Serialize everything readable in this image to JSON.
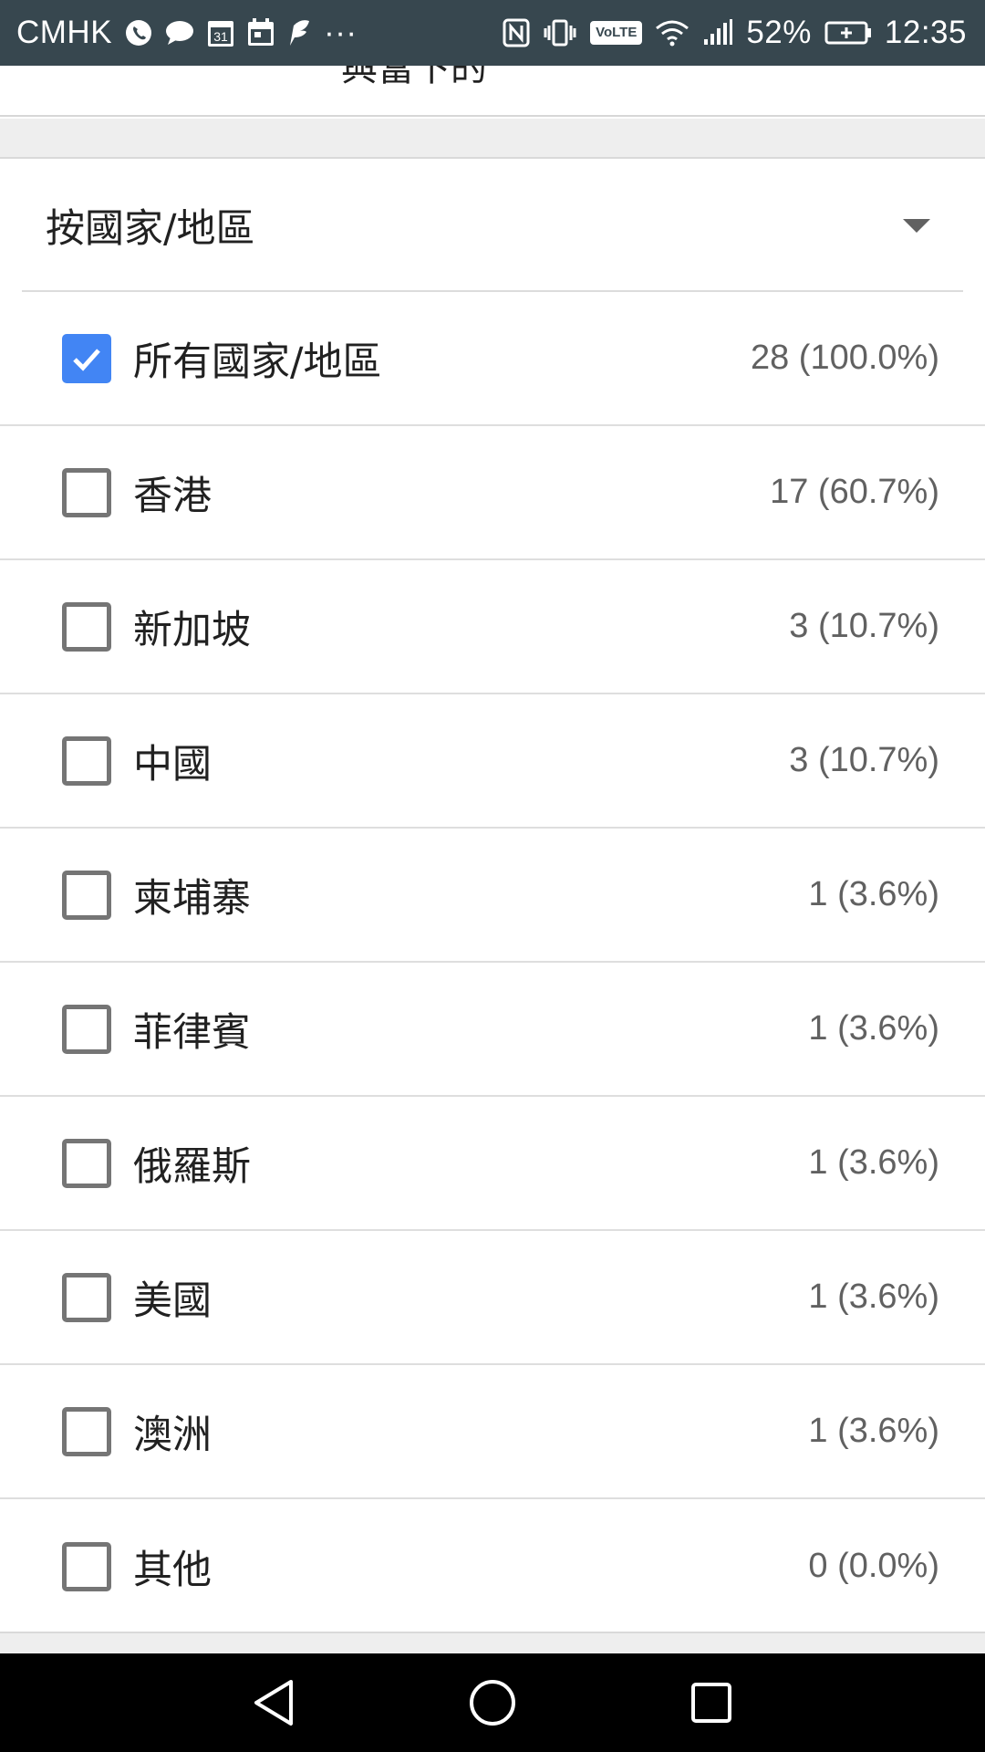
{
  "status_bar": {
    "carrier": "CMHK",
    "calendar_day": "31",
    "more": "···",
    "volte": "VoLTE",
    "battery_percent": "52%",
    "time": "12:35"
  },
  "top_card": {
    "cut_text": "與當下的"
  },
  "filter": {
    "dropdown_label": "按國家/地區",
    "items": [
      {
        "label": "所有國家/地區",
        "count": "28 (100.0%)",
        "checked": true
      },
      {
        "label": "香港",
        "count": "17 (60.7%)",
        "checked": false
      },
      {
        "label": "新加坡",
        "count": "3 (10.7%)",
        "checked": false
      },
      {
        "label": "中國",
        "count": "3 (10.7%)",
        "checked": false
      },
      {
        "label": "柬埔寨",
        "count": "1 (3.6%)",
        "checked": false
      },
      {
        "label": "菲律賓",
        "count": "1 (3.6%)",
        "checked": false
      },
      {
        "label": "俄羅斯",
        "count": "1 (3.6%)",
        "checked": false
      },
      {
        "label": "美國",
        "count": "1 (3.6%)",
        "checked": false
      },
      {
        "label": "澳洲",
        "count": "1 (3.6%)",
        "checked": false
      },
      {
        "label": "其他",
        "count": "0 (0.0%)",
        "checked": false
      }
    ]
  },
  "colors": {
    "status_bar": "#37474f",
    "checkbox_checked": "#4285f4",
    "checkbox_unchecked": "#757575"
  }
}
